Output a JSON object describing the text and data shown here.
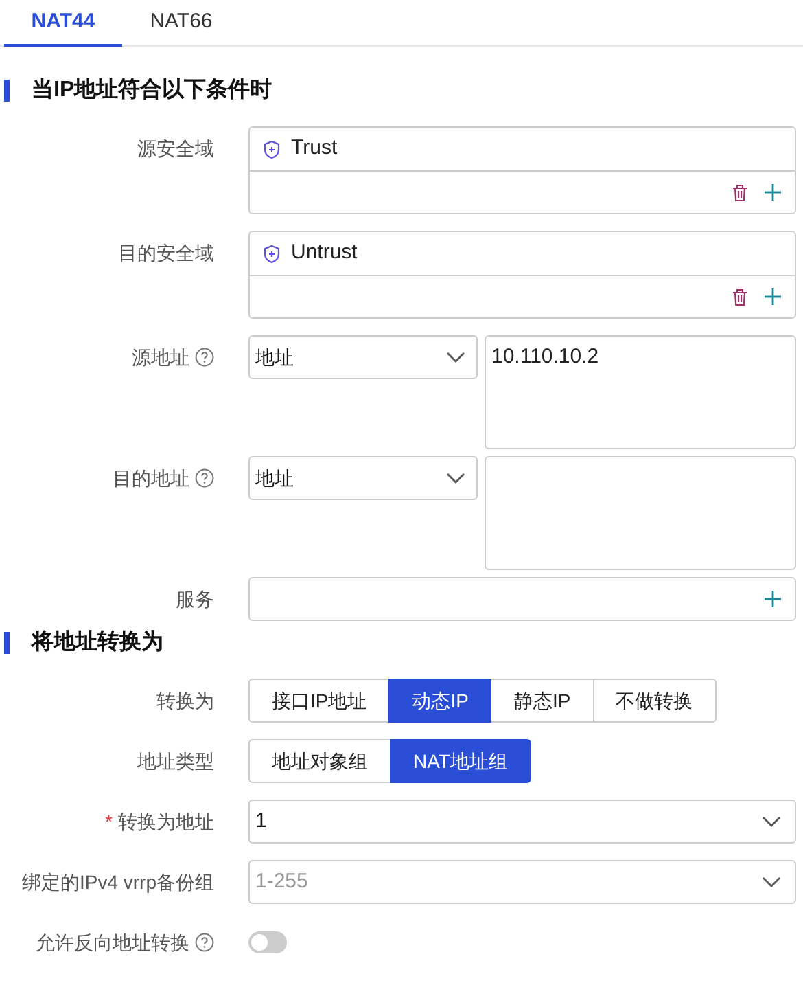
{
  "tabs": [
    {
      "label": "NAT44",
      "selected": true
    },
    {
      "label": "NAT66",
      "selected": false
    }
  ],
  "sections": [
    {
      "title": "当IP地址符合以下条件时",
      "fields": [
        {
          "kind": "zone",
          "label": "源安全域",
          "tags": [
            "Trust"
          ]
        },
        {
          "kind": "zone",
          "label": "目的安全域",
          "tags": [
            "Untrust"
          ]
        },
        {
          "kind": "address",
          "label": "源地址",
          "help": true,
          "select": "地址",
          "text": "10.110.10.2"
        },
        {
          "kind": "address",
          "label": "目的地址",
          "help": true,
          "select": "地址"
        },
        {
          "kind": "service",
          "label": "服务"
        }
      ]
    },
    {
      "title": "将地址转换为",
      "fields": [
        {
          "kind": "segmented",
          "label": "转换为",
          "options": [
            {
              "label": "接口IP地址",
              "selected": false
            },
            {
              "label": "动态IP",
              "selected": true
            },
            {
              "label": "静态IP",
              "selected": false
            },
            {
              "label": "不做转换",
              "selected": false
            }
          ]
        },
        {
          "kind": "segmented",
          "label": "地址类型",
          "options": [
            {
              "label": "地址对象组",
              "selected": false
            },
            {
              "label": "NAT地址组",
              "selected": true
            }
          ]
        },
        {
          "kind": "dropdown",
          "label": "转换为地址",
          "required_mark": "*",
          "value": "1"
        },
        {
          "kind": "dropdown",
          "label": "绑定的IPv4 vrrp备份组",
          "placeholder": "1-255"
        },
        {
          "kind": "toggle",
          "label": "允许反向地址转换",
          "help": true,
          "on": false
        }
      ]
    }
  ]
}
